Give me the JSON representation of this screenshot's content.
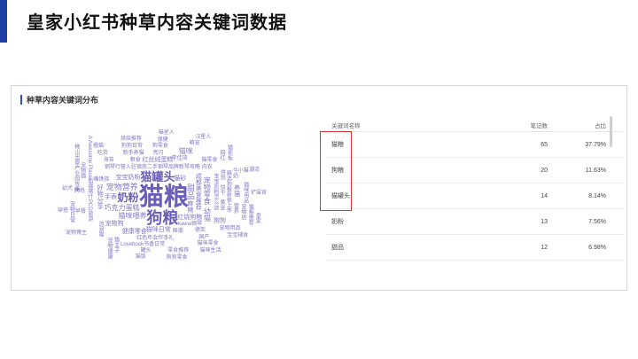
{
  "slide": {
    "title": "皇家小红书种草内容关键词数据",
    "accent_color": "#1f3fa8"
  },
  "panel": {
    "title": "种草内容关键词分布"
  },
  "word_cloud": {
    "color": "#6a5fb8",
    "words": [
      {
        "text": "猫粮",
        "size": 28
      },
      {
        "text": "狗粮",
        "size": 18
      },
      {
        "text": "猫罐头",
        "size": 13
      },
      {
        "text": "奶粉",
        "size": 12
      },
      {
        "text": "甜品",
        "size": 9
      },
      {
        "text": "宠物营养",
        "size": 9
      },
      {
        "text": "巧克力蛋糕",
        "size": 8
      },
      {
        "text": "成都美食推荐",
        "size": 7
      },
      {
        "text": "钢琴行营入驻镇南二手钢琴品牌新琴攻略 内衣",
        "size": 6
      },
      {
        "text": "红烧狗粮",
        "size": 7
      },
      {
        "text": "宠物零食",
        "size": 8
      },
      {
        "text": "猫咪喂养",
        "size": 8
      },
      {
        "text": "宝宝奶粉",
        "size": 7
      },
      {
        "text": "幼猫",
        "size": 8
      },
      {
        "text": "猫咪日常",
        "size": 7
      },
      {
        "text": "kawai钢琴",
        "size": 6
      },
      {
        "text": "宝宝奶粉怎么选",
        "size": 6
      },
      {
        "text": "红丝绒蛋糕",
        "size": 7
      },
      {
        "text": "猫砂",
        "size": 7
      },
      {
        "text": "好物分享",
        "size": 7
      },
      {
        "text": "健康零食",
        "size": 7
      },
      {
        "text": "手表",
        "size": 7
      },
      {
        "text": "麻辣",
        "size": 7
      },
      {
        "text": "国潮",
        "size": 6
      },
      {
        "text": "李佳琦",
        "size": 6
      },
      {
        "text": "饼干",
        "size": 6
      },
      {
        "text": "宠物狗",
        "size": 7
      },
      {
        "text": "粮食",
        "size": 6
      },
      {
        "text": "黄金",
        "size": 6
      },
      {
        "text": "红色年会伴手礼",
        "size": 6
      },
      {
        "text": "德芙",
        "size": 6
      },
      {
        "text": "精选狗粮新装上市",
        "size": 6
      },
      {
        "text": "嘴馋族",
        "size": 6
      },
      {
        "text": "亮闪",
        "size": 6
      },
      {
        "text": "A Awesome Place新疆喀什PCD旅游",
        "size": 6
      },
      {
        "text": "Lovebook书香日常",
        "size": 6
      },
      {
        "text": "狗狗",
        "size": 7
      },
      {
        "text": "养猫",
        "size": 7
      },
      {
        "text": "猫咪",
        "size": 8
      },
      {
        "text": "新手养猫",
        "size": 6
      },
      {
        "text": "烘焙",
        "size": 6
      },
      {
        "text": "猫零食",
        "size": 6
      },
      {
        "text": "国产",
        "size": 6
      },
      {
        "text": "营养",
        "size": 6
      },
      {
        "text": "海苔",
        "size": 6
      },
      {
        "text": "狗零食",
        "size": 6
      },
      {
        "text": "流浪猫",
        "size": 6
      },
      {
        "text": "烤鸡",
        "size": 6
      },
      {
        "text": "狗狗日常",
        "size": 6
      },
      {
        "text": "牛奶",
        "size": 6
      },
      {
        "text": "宠物用品",
        "size": 6
      },
      {
        "text": "早餐",
        "size": 6
      },
      {
        "text": "猫咪用品",
        "size": 6
      },
      {
        "text": "猫咪零食",
        "size": 6
      },
      {
        "text": "零食推荐",
        "size": 6
      },
      {
        "text": "宠物店",
        "size": 6
      },
      {
        "text": "罐头",
        "size": 6
      },
      {
        "text": "保健",
        "size": 6
      },
      {
        "text": "猫主子",
        "size": 6
      },
      {
        "text": "萌宠",
        "size": 6
      },
      {
        "text": "吃货",
        "size": 6
      },
      {
        "text": "网红",
        "size": 6
      },
      {
        "text": "烘焙推荐",
        "size": 6
      },
      {
        "text": "小猫",
        "size": 6
      },
      {
        "text": "宠物猫",
        "size": 6
      },
      {
        "text": "铲屎官",
        "size": 6
      },
      {
        "text": "宝宝辅食",
        "size": 6
      },
      {
        "text": "猫粮推荐",
        "size": 6
      },
      {
        "text": "猫咪生活",
        "size": 6
      },
      {
        "text": "狗狗零食",
        "size": 6
      },
      {
        "text": "宠物日常",
        "size": 6
      },
      {
        "text": "幼犬",
        "size": 6
      },
      {
        "text": "猫饭",
        "size": 6
      },
      {
        "text": "宠物健康",
        "size": 6
      },
      {
        "text": "喵星人",
        "size": 6
      },
      {
        "text": "汪星人",
        "size": 6
      },
      {
        "text": "猫抓板",
        "size": 6
      },
      {
        "text": "宠物博主",
        "size": 6
      },
      {
        "text": "撸猫",
        "size": 6
      },
      {
        "text": "梯山出察产业园攻略",
        "size": 6
      },
      {
        "text": "潮流",
        "size": 6
      },
      {
        "text": "穿搭",
        "size": 6
      },
      {
        "text": "皇家",
        "size": 6
      }
    ]
  },
  "table": {
    "headers": [
      "关键词名称",
      "笔记数",
      "占比"
    ],
    "rows": [
      {
        "keyword": "猫粮",
        "notes": "65",
        "share": "37.79%"
      },
      {
        "keyword": "狗粮",
        "notes": "20",
        "share": "11.63%"
      },
      {
        "keyword": "猫罐头",
        "notes": "14",
        "share": "8.14%"
      },
      {
        "keyword": "奶粉",
        "notes": "13",
        "share": "7.56%"
      },
      {
        "keyword": "甜品",
        "notes": "12",
        "share": "6.98%"
      }
    ],
    "highlight_color": "#d23a3a"
  }
}
